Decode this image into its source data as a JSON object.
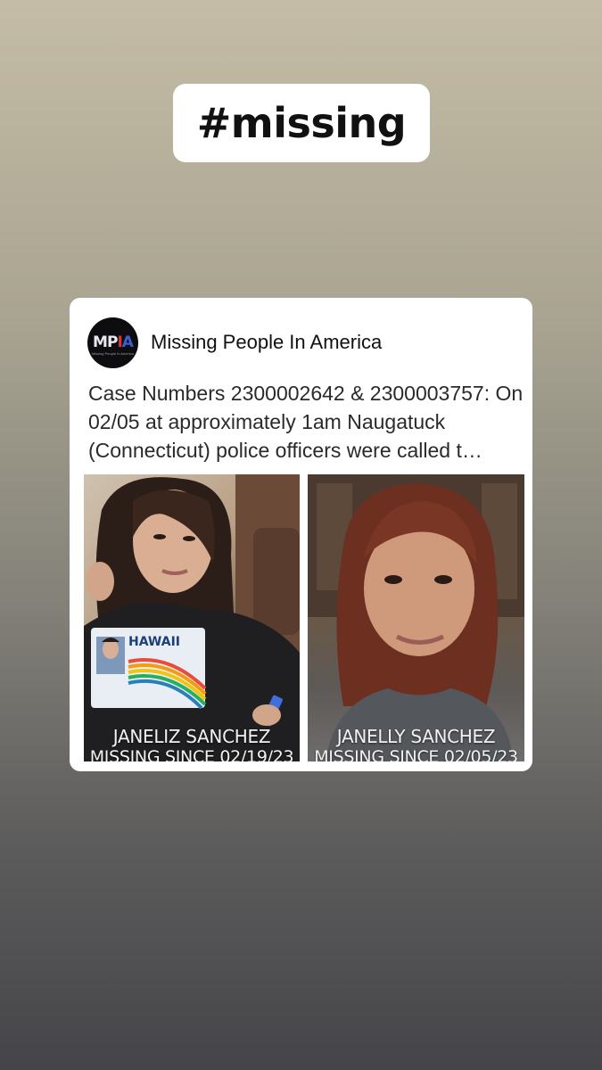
{
  "sticker": {
    "hashtag": "#missing"
  },
  "post": {
    "page_name": "Missing People In America",
    "avatar_text": "MPIA",
    "avatar_subtext": "Missing People In America",
    "text": "Case Numbers 2300002642 & 2300003757: On 02/05 at approximately 1am Naugatuck (Connecticut) police officers were called t…",
    "photos": [
      {
        "name_caption": "JANELIZ SANCHEZ",
        "since_caption": "MISSING SINCE 02/19/23",
        "id_card_text": "HAWAII"
      },
      {
        "name_caption": "JANELLY SANCHEZ",
        "since_caption": "MISSING SINCE 02/05/23"
      }
    ]
  }
}
